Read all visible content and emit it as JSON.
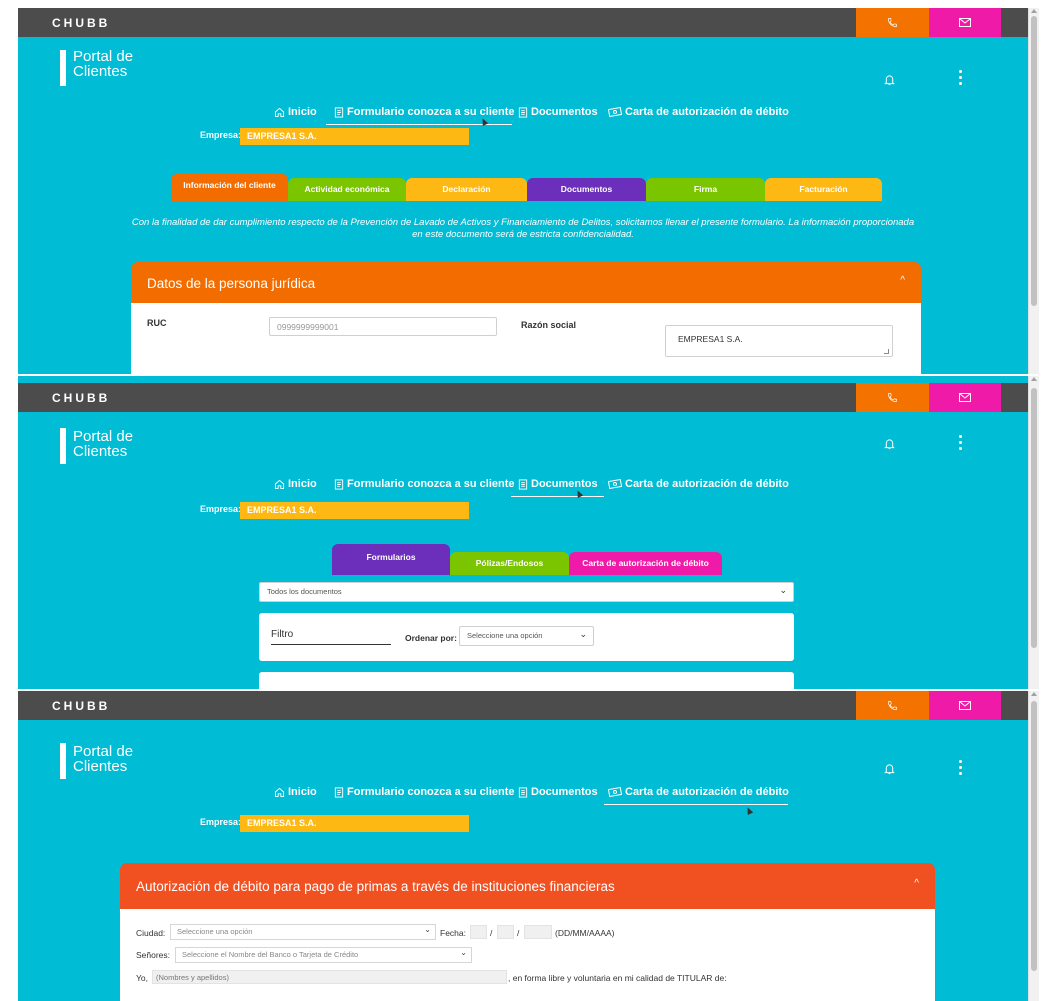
{
  "brand": "CHUBB",
  "icons": {
    "phone": "phone-icon",
    "mail": "mail-icon",
    "bell": "bell-icon",
    "menu": "kebab-menu-icon"
  },
  "colors": {
    "teal": "#00bcd4",
    "orange": "#f47200",
    "pink": "#ef1ba8",
    "yellow": "#fdb813",
    "purple": "#6b2fbb",
    "green": "#7ac400",
    "red": "#f15020",
    "topbar": "#4c4c4c"
  },
  "portal": {
    "line1": "Portal de",
    "line2": "Clientes"
  },
  "nav": {
    "inicio": "Inicio",
    "formulario": "Formulario conozca a su cliente",
    "documentos": "Documentos",
    "carta": "Carta de autorización de débito"
  },
  "empresa": {
    "label": "Empresa:",
    "value": "EMPRESA1 S.A."
  },
  "screen1": {
    "tabs": [
      "Información del cliente",
      "Actividad económica",
      "Declaración",
      "Documentos",
      "Firma",
      "Facturación"
    ],
    "intro": "Con la finalidad de dar cumplimiento respecto de la Prevención de Lavado de Activos y Financiamiento de Delitos, solicitamos llenar el presente formulario. La información proporcionada en este documento será de estricta confidencialidad.",
    "panel_title": "Datos de la persona jurídica",
    "ruc_label": "RUC",
    "ruc_value": "0999999999001",
    "razon_label": "Razón social",
    "razon_value": "EMPRESA1 S.A."
  },
  "screen2": {
    "tabs": [
      "Formularios",
      "Pólizas/Endosos",
      "Carta de autorización de débito"
    ],
    "doc_select": "Todos los documentos",
    "filtro": "Filtro",
    "ordenar_label": "Ordenar por:",
    "ordenar_value": "Seleccione una opción"
  },
  "screen3": {
    "panel_title": "Autorización de débito para pago de primas a través de instituciones financieras",
    "ciudad_label": "Ciudad:",
    "ciudad_value": "Seleccione una opción",
    "fecha_label": "Fecha:",
    "fecha_format": "(DD/MM/AAAA)",
    "senores_label": "Señores:",
    "senores_value": "Seleccione el Nombre del Banco o Tarjeta de Crédito",
    "yo_label": "Yo,",
    "yo_placeholder": "(Nombres y apellidos)",
    "yo_suffix": ", en forma libre y voluntaria en mi calidad de TITULAR de:"
  }
}
